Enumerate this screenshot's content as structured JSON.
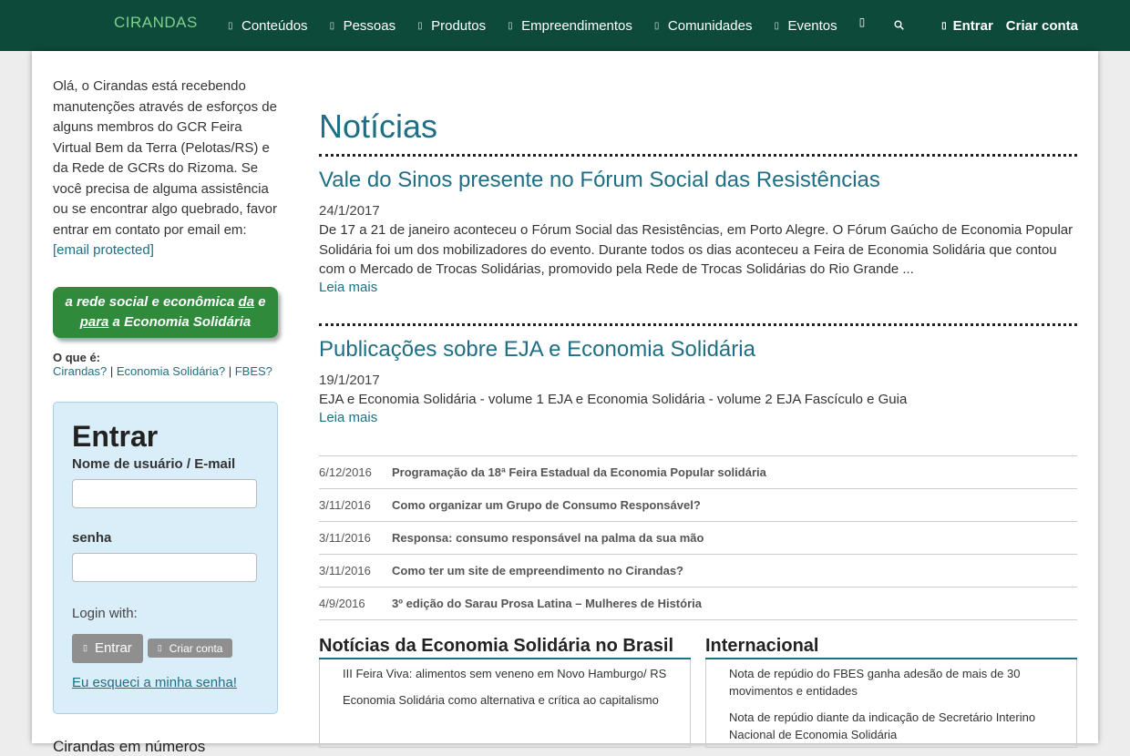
{
  "topbar": {
    "brand": "CIRANDAS",
    "nav": [
      {
        "label": "Conteúdos",
        "icon": "file-icon"
      },
      {
        "label": "Pessoas",
        "icon": "user-icon"
      },
      {
        "label": "Produtos",
        "icon": "product-icon"
      },
      {
        "label": "Empreendimentos",
        "icon": "building-icon"
      },
      {
        "label": "Comunidades",
        "icon": "community-icon"
      },
      {
        "label": "Eventos",
        "icon": "calendar-icon"
      }
    ],
    "extra_glyph": "▯",
    "search_glyph": "🔍︎",
    "login_label": "Entrar",
    "signup_label": "Criar conta",
    "brand_color": "#0e4a3a"
  },
  "sidebar": {
    "intro": "Olá, o Cirandas está recebendo manutenções através de esforços de alguns membros do GCR Feira Virtual Bem da Terra (Pelotas/RS) e da Rede de GCRs do Rizoma. Se você precisa de alguma assistência ou se encontrar algo quebrado, favor entrar em contato por email em:",
    "email": "[email protected]",
    "tagline_pre": "a rede social e econômica ",
    "tagline_da": "da",
    "tagline_mid": " e ",
    "tagline_para": "para",
    "tagline_post": " a Economia Solidária",
    "whatis_label": "O que é:",
    "whatis_links": [
      "Cirandas?",
      "Economia Solidária?",
      "FBES?"
    ],
    "whatis_sep": " | ",
    "login": {
      "title": "Entrar",
      "user_label": "Nome de usuário / E-mail",
      "pass_label": "senha",
      "login_with": "Login with:",
      "enter_button": "Entrar",
      "create_button": "Criar conta",
      "forgot": "Eu esqueci a minha senha!"
    },
    "numbers_title": "Cirandas em números"
  },
  "main": {
    "title": "Notícias",
    "articles": [
      {
        "title": "Vale do Sinos presente no Fórum Social das Resistências",
        "date": "24/1/2017",
        "excerpt": " De 17 a 21 de janeiro aconteceu o Fórum Social das Resistências, em Porto Alegre. O Fórum Gaúcho de Economia Popular Solidária foi um dos mobilizadores do evento. Durante todos os dias aconteceu a Feira de Economia Solidária que contou com o Mercado de Trocas Solidárias, promovido pela Rede de Trocas Solidárias do Rio Grande ...",
        "more": "Leia mais"
      },
      {
        "title": "Publicações sobre EJA e Economia Solidária",
        "date": "19/1/2017",
        "excerpt": "EJA e Economia Solidária - volume 1 EJA e Economia Solidária - volume 2 EJA Fascículo e Guia",
        "more": "Leia mais"
      }
    ],
    "list": [
      {
        "date": "6/12/2016",
        "title": "Programação da 18ª Feira Estadual da Economia Popular solidária"
      },
      {
        "date": "3/11/2016",
        "title": "Como organizar um Grupo de Consumo Responsável?"
      },
      {
        "date": "3/11/2016",
        "title": "Responsa: consumo responsável na palma da sua mão"
      },
      {
        "date": "3/11/2016",
        "title": "Como ter um site de empreendimento no Cirandas?"
      },
      {
        "date": "4/9/2016",
        "title": "3º edição do Sarau Prosa Latina – Mulheres de História"
      }
    ],
    "columns": [
      {
        "title": "Notícias da Economia Solidária no Brasil",
        "items": [
          "III Feira Viva: alimentos sem veneno em Novo Hamburgo/ RS",
          "Economia Solidária como alternativa e crítica ao capitalismo"
        ]
      },
      {
        "title": "Internacional",
        "items": [
          "Nota de repúdio do FBES ganha adesão de mais de 30 movimentos e entidades",
          "Nota de repúdio diante da indicação de Secretário Interino Nacional de Economia Solidária"
        ]
      }
    ]
  }
}
